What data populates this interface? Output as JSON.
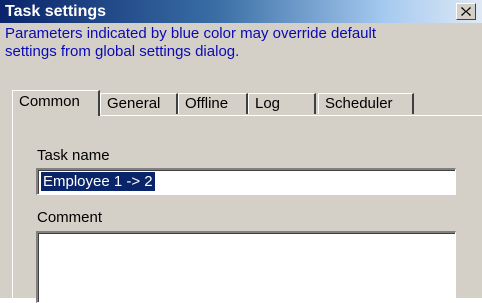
{
  "window": {
    "title": "Task settings",
    "close_glyph": "✕"
  },
  "info_lines": [
    "Parameters indicated by blue color may override default",
    "settings from global settings dialog."
  ],
  "tabs": [
    {
      "label": "Common",
      "active": true
    },
    {
      "label": "General",
      "active": false
    },
    {
      "label": "Offline",
      "active": false
    },
    {
      "label": "Log",
      "active": false
    },
    {
      "label": "Scheduler",
      "active": false
    }
  ],
  "form": {
    "task_name_label": "Task name",
    "task_name_value": "Employee 1 -> 2",
    "comment_label": "Comment",
    "comment_value": ""
  },
  "colors": {
    "info_text": "#0a0ab4",
    "selection": "#0a246a"
  }
}
